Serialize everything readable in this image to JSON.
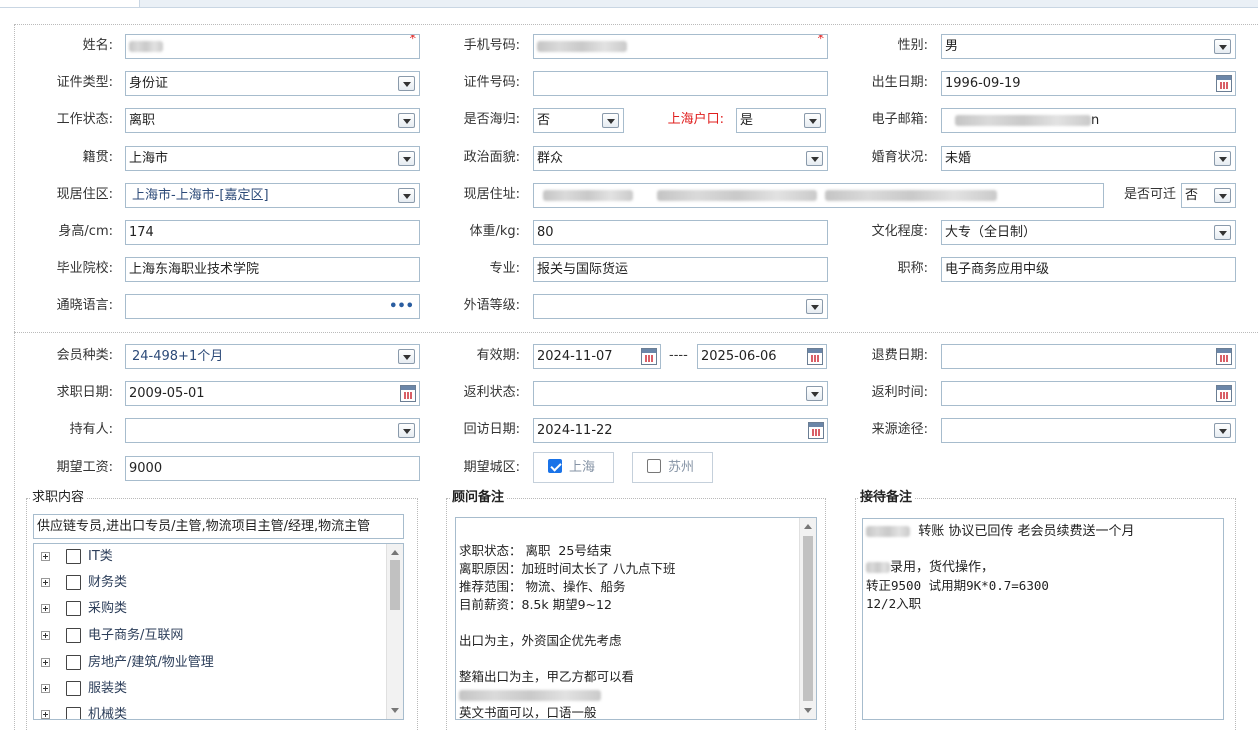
{
  "form": {
    "name": {
      "label": "姓名:",
      "required_mark": "*"
    },
    "phone": {
      "label": "手机号码:",
      "required_mark": "*"
    },
    "gender": {
      "label": "性别:",
      "value": "男"
    },
    "id_type": {
      "label": "证件类型:",
      "value": "身份证"
    },
    "id_number": {
      "label": "证件号码:",
      "value": ""
    },
    "birth_date": {
      "label": "出生日期:",
      "value": "1996-09-19"
    },
    "work_status": {
      "label": "工作状态:",
      "value": "离职"
    },
    "returnee": {
      "label": "是否海归:",
      "value": "否"
    },
    "shanghai_hukou": {
      "label": "上海户口:",
      "value": "是"
    },
    "email": {
      "label": "电子邮箱:",
      "visible_tail": "n"
    },
    "native_place": {
      "label": "籍贯:",
      "value": "上海市"
    },
    "political_status": {
      "label": "政治面貌:",
      "value": "群众"
    },
    "marital_status": {
      "label": "婚育状况:",
      "value": "未婚"
    },
    "residence_area": {
      "label": "现居住区:",
      "value": "上海市-上海市-[嘉定区]"
    },
    "residence_address": {
      "label": "现居住址:"
    },
    "relocatable": {
      "label": "是否可迁",
      "value": "否"
    },
    "height": {
      "label": "身高/cm:",
      "value": "174"
    },
    "weight": {
      "label": "体重/kg:",
      "value": "80"
    },
    "education": {
      "label": "文化程度:",
      "value": "大专（全日制）"
    },
    "school": {
      "label": "毕业院校:",
      "value": "上海东海职业技术学院"
    },
    "major": {
      "label": "专业:",
      "value": "报关与国际货运"
    },
    "title": {
      "label": "职称:",
      "value": "电子商务应用中级"
    },
    "languages": {
      "label": "通晓语言:",
      "value": "",
      "more": "•••"
    },
    "foreign_level": {
      "label": "外语等级:",
      "value": ""
    }
  },
  "membership": {
    "member_type": {
      "label": "会员种类:",
      "value": "24-498+1个月"
    },
    "valid_period": {
      "label": "有效期:",
      "start": "2024-11-07",
      "separator": "----",
      "end": "2025-06-06"
    },
    "refund_date": {
      "label": "退费日期:",
      "value": ""
    },
    "job_search_date": {
      "label": "求职日期:",
      "value": "2009-05-01"
    },
    "rebate_status": {
      "label": "返利状态:",
      "value": ""
    },
    "rebate_time": {
      "label": "返利时间:",
      "value": ""
    },
    "holder": {
      "label": "持有人:",
      "value": ""
    },
    "revisit_date": {
      "label": "回访日期:",
      "value": "2024-11-22"
    },
    "source": {
      "label": "来源途径:",
      "value": ""
    },
    "expected_salary": {
      "label": "期望工资:",
      "value": "9000"
    },
    "expected_city": {
      "label": "期望城区:",
      "options": [
        {
          "label": "上海",
          "checked": true
        },
        {
          "label": "苏州",
          "checked": false
        }
      ]
    }
  },
  "job_content": {
    "title": "求职内容",
    "selected_text": "供应链专员,进出口专员/主管,物流项目主管/经理,物流主管",
    "tree": [
      "IT类",
      "财务类",
      "采购类",
      "电子商务/互联网",
      "房地产/建筑/物业管理",
      "服装类",
      "机械类"
    ]
  },
  "advisor_notes": {
    "title": "顾问备注",
    "lines": [
      "",
      "求职状态： 离职  25号结束",
      "离职原因：加班时间太长了 八九点下班",
      "推荐范围： 物流、操作、船务",
      "目前薪资：8.5k 期望9~12",
      "",
      "出口为主，外资国企优先考虑",
      "",
      "整箱出口为主，甲乙方都可以看",
      "",
      "英文书面可以，口语一般"
    ]
  },
  "reception_notes": {
    "title": "接待备注",
    "line1": "转账 协议已回传  老会员续费送一个月",
    "line2": "录用，货代操作，",
    "line3": "转正9500 试用期9K*0.7=6300",
    "line4": "12/2入职"
  }
}
